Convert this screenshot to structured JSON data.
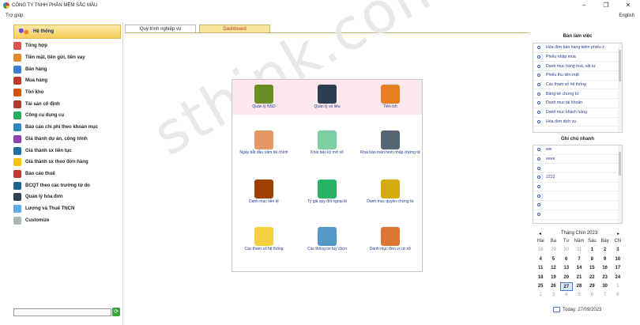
{
  "titlebar": {
    "title": "CÔNG TY TNHH PHẦN MỀM SẮC MÀU",
    "minimize": "–",
    "maximize": "❐",
    "close": "✕"
  },
  "menubar": {
    "help": "Trợ giúp",
    "language": "English"
  },
  "sidebar": {
    "header": "Hệ thống",
    "items": [
      {
        "label": "Tổng hợp",
        "color": "#d9534f"
      },
      {
        "label": "Tiền mặt, tiền gửi, tiền vay",
        "color": "#e08a2c"
      },
      {
        "label": "Bán hàng",
        "color": "#3c7dd9"
      },
      {
        "label": "Mua hàng",
        "color": "#c0392b"
      },
      {
        "label": "Tồn kho",
        "color": "#d35400"
      },
      {
        "label": "Tài sản cố định",
        "color": "#b03a2e"
      },
      {
        "label": "Công cụ dụng cụ",
        "color": "#27ae60"
      },
      {
        "label": "Báo cáo chi phí theo khoản mục",
        "color": "#2e86c1"
      },
      {
        "label": "Giá thành dự án, công trình",
        "color": "#8e44ad"
      },
      {
        "label": "Giá thành sx liên tục",
        "color": "#2471a3"
      },
      {
        "label": "Giá thành sx theo đơn hàng",
        "color": "#f1c40f"
      },
      {
        "label": "Báo cáo thuế",
        "color": "#c0392b"
      },
      {
        "label": "BCQT theo các trường từ do",
        "color": "#1f618d"
      },
      {
        "label": "Quản lý hóa đơn",
        "color": "#2e4053"
      },
      {
        "label": "Lương và Thuế TNCN",
        "color": "#5dade2"
      },
      {
        "label": "Customize",
        "color": "#aab7b8"
      }
    ],
    "search_value": "",
    "go_symbol": "⟳"
  },
  "tabs": {
    "process": "Quy trình nghiệp vụ",
    "dashboard": "Dashboard"
  },
  "panel": {
    "items": [
      {
        "label": "Quản lý NSD",
        "color": "#6b8e23"
      },
      {
        "label": "Quản lý số liệu",
        "color": "#2c3e50"
      },
      {
        "label": "Tiện ích",
        "color": "#e67e22"
      },
      {
        "label": "Ngày bắt đầu năm tài chính",
        "color": "#e59866"
      },
      {
        "label": "Khai báo kỳ mở sổ",
        "color": "#7dcea0"
      },
      {
        "label": "Khai báo màn hình nhập chứng từ",
        "color": "#566573"
      },
      {
        "label": "Danh mục tiền tệ",
        "color": "#a04000"
      },
      {
        "label": "Tỷ giá quy đổi ngoại tệ",
        "color": "#28b463"
      },
      {
        "label": "Danh mục quyền chứng từ",
        "color": "#d4ac0d"
      },
      {
        "label": "Các tham số hệ thống",
        "color": "#f4d03f"
      },
      {
        "label": "Các thông tin tùy chọn",
        "color": "#5499c7"
      },
      {
        "label": "Danh mục đơn vị cơ sở",
        "color": "#dc7633"
      }
    ]
  },
  "watermark": "sthink.com.vn",
  "workspace": {
    "title": "Bàn làm việc",
    "items": [
      "Hóa đơn bán hàng kiêm phiếu x",
      "Phiếu nhập mua",
      "Danh mục hàng hoá, vật tư",
      "Phiếu thu tiền mặt",
      "Các tham số hệ thống",
      "Bảng kê chứng từ",
      "Danh mục tài khoản",
      "Danh mục khách hàng",
      "Hóa đơn dịch vụ"
    ]
  },
  "quicknotes": {
    "title": "Ghi chú nhanh",
    "items": [
      "ww",
      "eeee",
      "",
      "2222",
      "",
      "",
      "",
      ""
    ]
  },
  "calendar": {
    "month_label": "Tháng Chín 2023",
    "prev": "◂",
    "next": "▸",
    "weekdays": [
      "Hai",
      "Ba",
      "Tư",
      "Năm",
      "Sáu",
      "Bảy",
      "CN"
    ],
    "weeks": [
      [
        "28",
        "29",
        "30",
        "31",
        "1",
        "2",
        "3"
      ],
      [
        "4",
        "5",
        "6",
        "7",
        "8",
        "9",
        "10"
      ],
      [
        "11",
        "12",
        "13",
        "14",
        "15",
        "16",
        "17"
      ],
      [
        "18",
        "19",
        "20",
        "21",
        "22",
        "23",
        "24"
      ],
      [
        "25",
        "26",
        "27",
        "28",
        "29",
        "30",
        "1"
      ],
      [
        "2",
        "3",
        "4",
        "5",
        "6",
        "7",
        "8"
      ]
    ],
    "today_label": "Today: 27/09/2023"
  }
}
